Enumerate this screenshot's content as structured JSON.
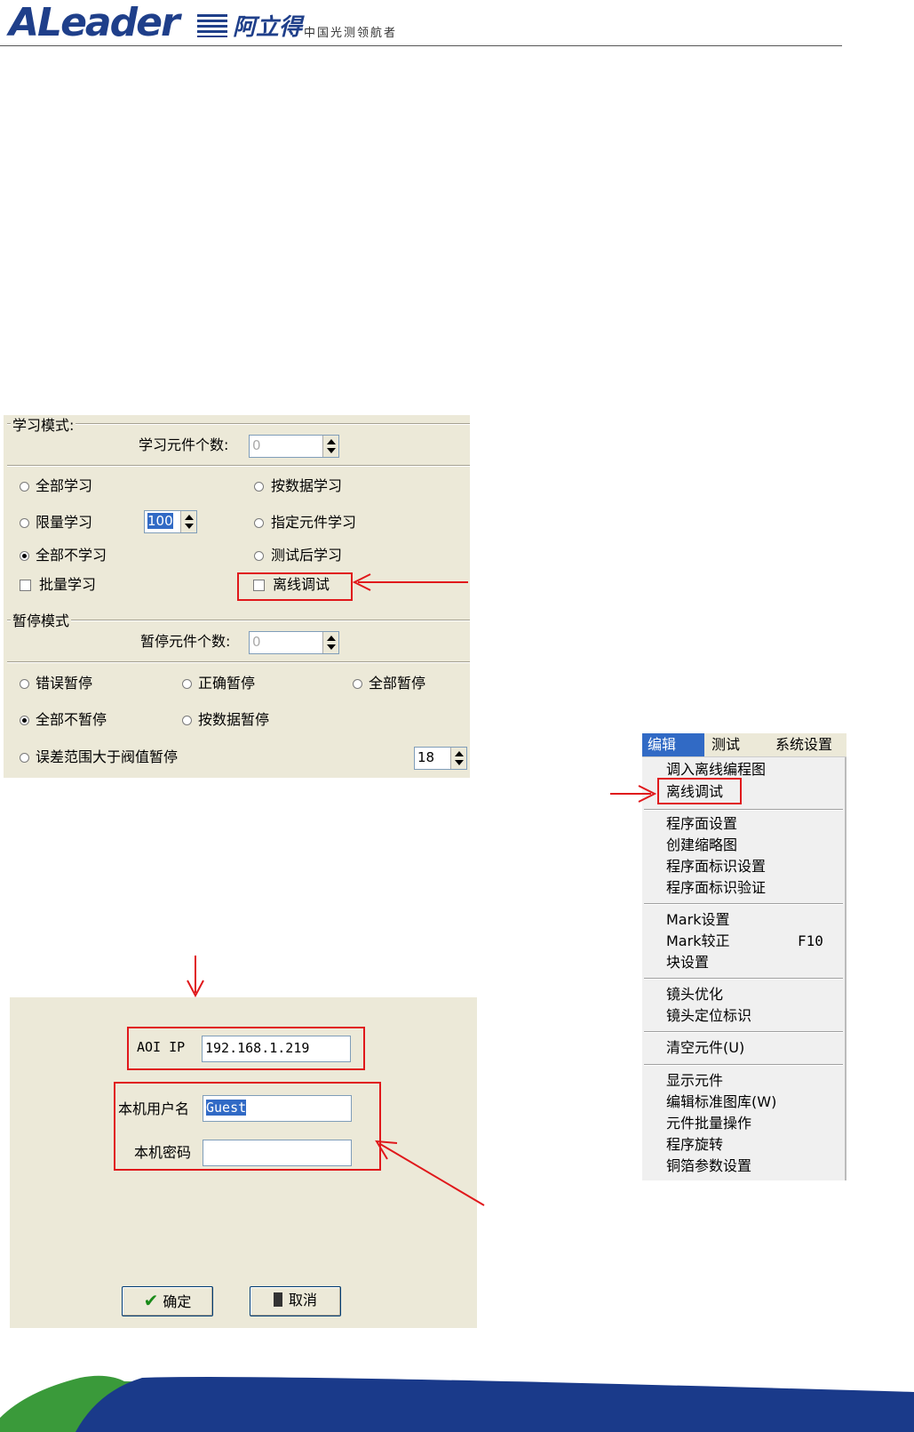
{
  "header": {
    "logo_text": "ALeader",
    "logo_cn": "阿立得",
    "slogan": "中国光测领航者"
  },
  "learn_panel": {
    "group_title": "学习模式:",
    "count_label": "学习元件个数:",
    "count_value": "0",
    "options": {
      "all_learn": "全部学习",
      "by_data_learn": "按数据学习",
      "limit_learn": "限量学习",
      "limit_value": "100",
      "specified_learn": "指定元件学习",
      "no_learn": "全部不学习",
      "after_test_learn": "测试后学习",
      "batch_learn": "批量学习",
      "offline_debug": "离线调试"
    }
  },
  "pause_panel": {
    "group_title": "暂停模式",
    "count_label": "暂停元件个数:",
    "count_value": "0",
    "options": {
      "error_pause": "错误暂停",
      "correct_pause": "正确暂停",
      "all_pause": "全部暂停",
      "no_pause": "全部不暂停",
      "by_data_pause": "按数据暂停",
      "threshold_pause": "误差范围大于阀值暂停",
      "threshold_value": "18"
    }
  },
  "menu": {
    "bar": [
      "编辑",
      "测试",
      "系统设置"
    ],
    "items": [
      {
        "label": "调入离线编程图"
      },
      {
        "label": "离线调试"
      },
      {
        "label": "程序面设置"
      },
      {
        "label": "创建缩略图"
      },
      {
        "label": "程序面标识设置"
      },
      {
        "label": "程序面标识验证"
      },
      {
        "label": "Mark设置"
      },
      {
        "label": "Mark较正",
        "shortcut": "F10"
      },
      {
        "label": "块设置"
      },
      {
        "label": "镜头优化"
      },
      {
        "label": "镜头定位标识"
      },
      {
        "label": "清空元件(U)"
      },
      {
        "label": "显示元件"
      },
      {
        "label": "编辑标准图库(W)"
      },
      {
        "label": "元件批量操作"
      },
      {
        "label": "程序旋转"
      },
      {
        "label": "铜箔参数设置"
      }
    ]
  },
  "login_panel": {
    "aoi_ip_label": "AOI IP",
    "aoi_ip_value": "192.168.1.219",
    "username_label": "本机用户名",
    "username_value": "Guest",
    "password_label": "本机密码",
    "password_value": "",
    "ok_label": "确定",
    "cancel_label": "取消"
  },
  "colors": {
    "panel_bg": "#ece9d8",
    "annotation_red": "#e0181b",
    "brand_blue": "#1f3f8a",
    "footer_green": "#3a9a3a",
    "footer_blue": "#1a3a8a",
    "selection_blue": "#316ac5"
  }
}
